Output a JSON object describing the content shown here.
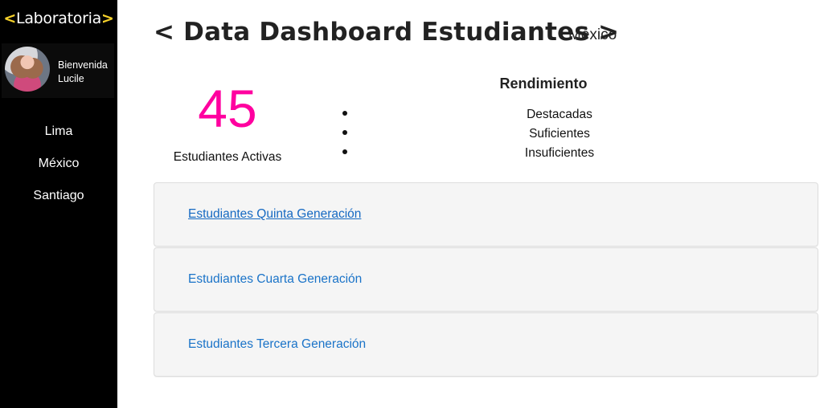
{
  "brand": {
    "open": "<",
    "name": "Laboratoria",
    "close": ">",
    "accent": "#f7d22b"
  },
  "profile": {
    "greeting": "Bienvenida",
    "name": "Lucile"
  },
  "nav": {
    "items": [
      "Lima",
      "México",
      "Santiago"
    ]
  },
  "header": {
    "title": "< Data Dashboard Estudiantes >",
    "subtitle": "México"
  },
  "stats": {
    "active_count": "45",
    "active_label": "Estudiantes Activas",
    "count_color": "#ff009f"
  },
  "performance": {
    "title": "Rendimiento",
    "items": [
      "Destacadas",
      "Suficientes",
      "Insuficientes"
    ]
  },
  "generations": [
    {
      "label": "Estudiantes Quinta Generación",
      "underlined": true
    },
    {
      "label": "Estudiantes Cuarta Generación",
      "underlined": false
    },
    {
      "label": "Estudiantes Tercera Generación",
      "underlined": false
    }
  ],
  "colors": {
    "link": "#1a73c8",
    "sidebar_bg": "#000000",
    "panel_bg": "#f5f5f5"
  }
}
